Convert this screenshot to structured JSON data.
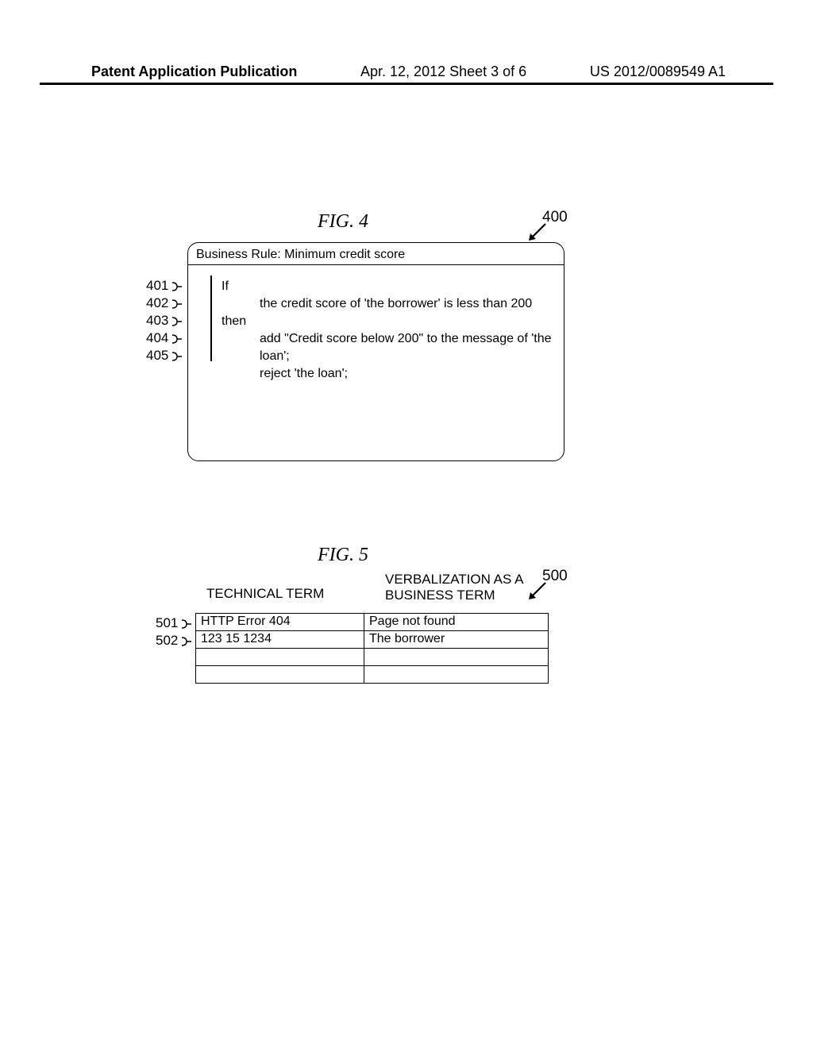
{
  "header": {
    "left": "Patent Application Publication",
    "center": "Apr. 12, 2012  Sheet 3 of 6",
    "right": "US 2012/0089549 A1"
  },
  "fig4": {
    "title": "FIG. 4",
    "callout": "400",
    "rule_title": "Business Rule: Minimum credit score",
    "lines": {
      "l1": "If",
      "l2": "the credit score of 'the borrower' is less than 200",
      "l3": "then",
      "l4": "add \"Credit score below 200\" to the message of 'the loan';",
      "l5": "reject 'the loan';"
    },
    "row_labels": [
      "401",
      "402",
      "403",
      "404",
      "405"
    ]
  },
  "fig5": {
    "title": "FIG. 5",
    "callout": "500",
    "headers": {
      "technical": "TECHNICAL TERM",
      "verbalization": "VERBALIZATION AS A\nBUSINESS TERM"
    },
    "rows": [
      {
        "tech": "HTTP Error 404",
        "verb": "Page not found"
      },
      {
        "tech": "123 15 1234",
        "verb": "The borrower"
      },
      {
        "tech": "",
        "verb": ""
      },
      {
        "tech": "",
        "verb": ""
      }
    ],
    "row_labels": [
      "501",
      "502"
    ]
  }
}
